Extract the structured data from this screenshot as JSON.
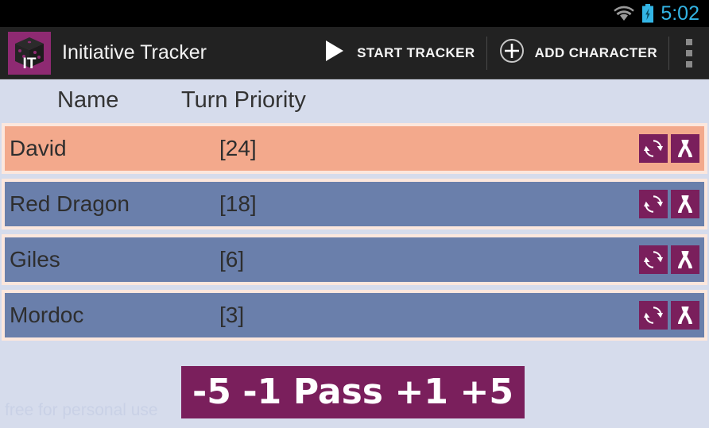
{
  "status_bar": {
    "time": "5:02",
    "wifi_icon": "wifi-icon",
    "battery_icon": "battery-charging-icon",
    "accent_color": "#33b5e5"
  },
  "action_bar": {
    "app_icon": "dice-it-logo-icon",
    "title": "Initiative Tracker",
    "actions": [
      {
        "label": "START TRACKER",
        "icon": "play-icon"
      },
      {
        "label": "ADD CHARACTER",
        "icon": "plus-circle-icon"
      }
    ],
    "overflow_icon": "overflow-menu-icon",
    "background_color": "#222222"
  },
  "list": {
    "headers": {
      "name": "Name",
      "priority": "Turn Priority"
    },
    "row_buttons": {
      "refresh_icon": "refresh-icon",
      "delete_icon": "close-x-icon"
    },
    "active_color": "#f3a98c",
    "inactive_color": "#6a7fab",
    "border_color": "#fce7dd",
    "rows": [
      {
        "name": "David",
        "priority": "[24]",
        "active": true
      },
      {
        "name": "Red Dragon",
        "priority": "[18]",
        "active": false
      },
      {
        "name": "Giles",
        "priority": "[6]",
        "active": false
      },
      {
        "name": "Mordoc",
        "priority": "[3]",
        "active": false
      }
    ]
  },
  "pass_bar": {
    "background_color": "#7a1f5c",
    "buttons": [
      {
        "label": "-5"
      },
      {
        "label": "-1"
      },
      {
        "label": "Pass"
      },
      {
        "label": "+1"
      },
      {
        "label": "+5"
      }
    ]
  },
  "watermark": {
    "text": "free for personal use"
  }
}
